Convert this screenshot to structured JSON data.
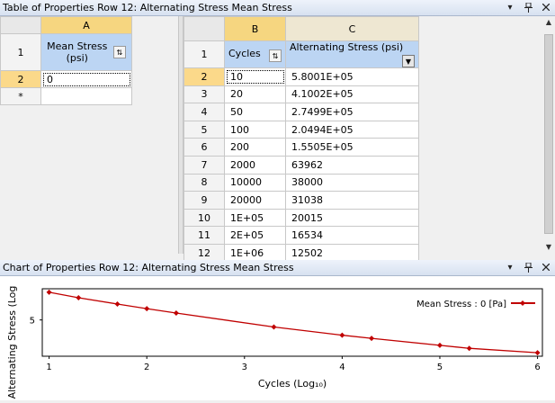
{
  "table_panel": {
    "title": "Table of Properties Row 12: Alternating Stress Mean Stress",
    "controls": [
      "▾",
      "📌",
      "✕"
    ]
  },
  "left_table": {
    "col_letter": "A",
    "header": "Mean Stress (psi)",
    "header_line1": "Mean Stress",
    "header_line2": "(psi)",
    "rows": [
      {
        "num": "1"
      },
      {
        "num": "2",
        "value": "0"
      },
      {
        "num": "*",
        "value": ""
      }
    ]
  },
  "right_table": {
    "col_letters": [
      "B",
      "C"
    ],
    "headers": [
      "Cycles",
      "Alternating Stress (psi)"
    ],
    "header_row_num": "1",
    "rows": [
      {
        "num": "2",
        "cycles": "10",
        "stress": "5.8001E+05"
      },
      {
        "num": "3",
        "cycles": "20",
        "stress": "4.1002E+05"
      },
      {
        "num": "4",
        "cycles": "50",
        "stress": "2.7499E+05"
      },
      {
        "num": "5",
        "cycles": "100",
        "stress": "2.0494E+05"
      },
      {
        "num": "6",
        "cycles": "200",
        "stress": "1.5505E+05"
      },
      {
        "num": "7",
        "cycles": "2000",
        "stress": "63962"
      },
      {
        "num": "8",
        "cycles": "10000",
        "stress": "38000"
      },
      {
        "num": "9",
        "cycles": "20000",
        "stress": "31038"
      },
      {
        "num": "10",
        "cycles": "1E+05",
        "stress": "20015"
      },
      {
        "num": "11",
        "cycles": "2E+05",
        "stress": "16534"
      },
      {
        "num": "12",
        "cycles": "1E+06",
        "stress": "12502"
      }
    ]
  },
  "chart_panel": {
    "title": "Chart of Properties Row 12: Alternating Stress Mean Stress"
  },
  "chart_data": {
    "type": "line",
    "xlabel": "Cycles (Log₁₀)",
    "ylabel": "Alternating Stress (Log",
    "x_ticks": [
      "1",
      "2",
      "3",
      "4",
      "5",
      "6"
    ],
    "y_ticks": [
      "5"
    ],
    "xlim": [
      0.93,
      6.05
    ],
    "ylim": [
      4.0,
      5.86
    ],
    "legend": "Mean Stress : 0 [Pa]",
    "legend_position": "top-right",
    "color": "#c00000",
    "series": [
      {
        "name": "Mean Stress : 0 [Pa]",
        "x": [
          1,
          1.301,
          1.699,
          2,
          2.301,
          3.301,
          4,
          4.301,
          5,
          5.301,
          6
        ],
        "y": [
          5.763,
          5.613,
          5.439,
          5.312,
          5.19,
          4.806,
          4.58,
          4.492,
          4.301,
          4.218,
          4.097
        ]
      }
    ]
  }
}
